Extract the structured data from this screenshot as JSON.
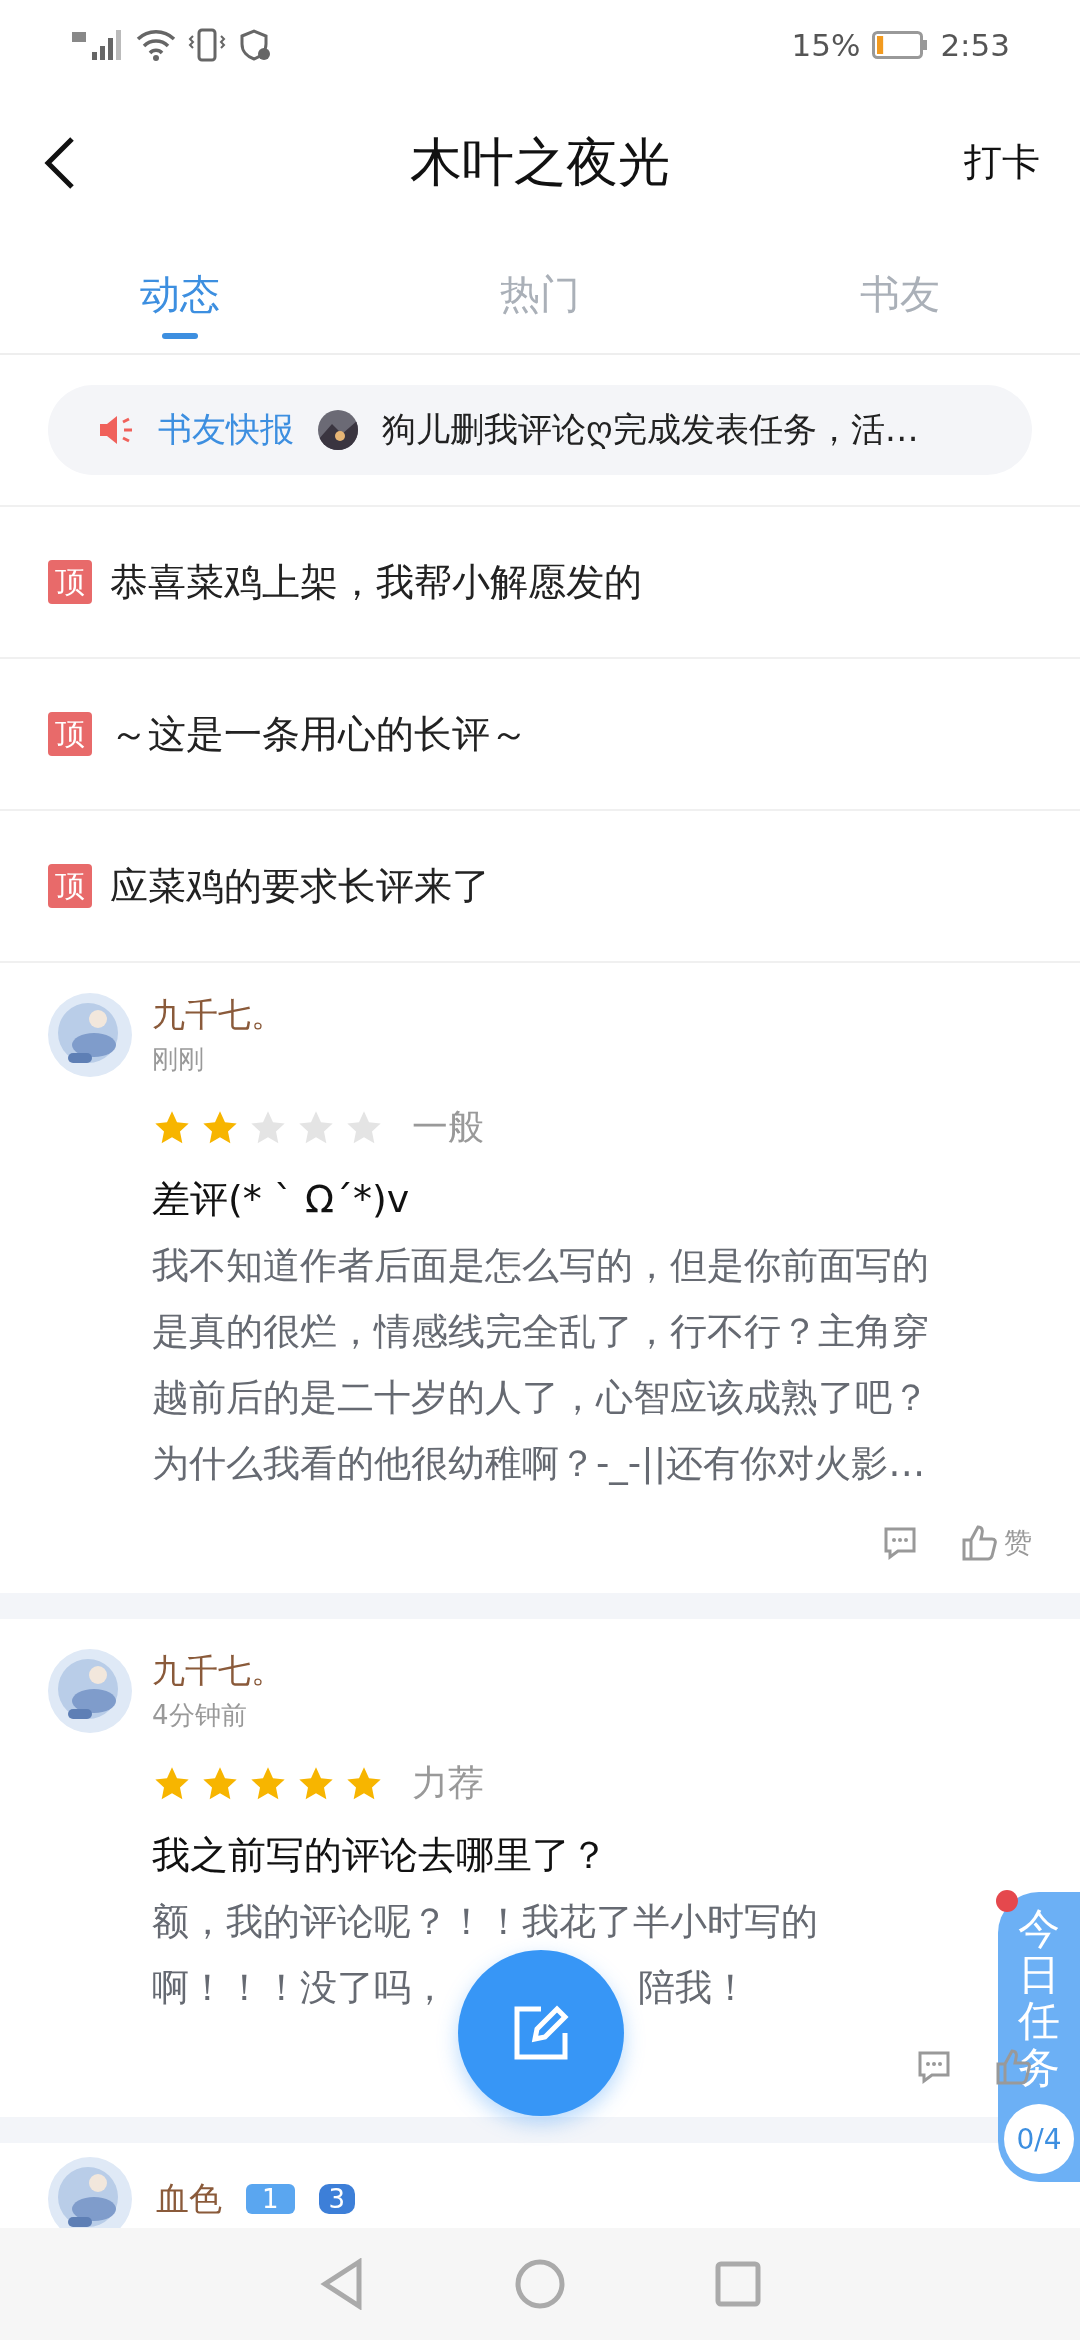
{
  "status_bar": {
    "battery": "15%",
    "time": "2:53"
  },
  "header": {
    "title": "木叶之夜光",
    "action": "打卡"
  },
  "tabs": [
    {
      "label": "动态",
      "selected": true
    },
    {
      "label": "热门",
      "selected": false
    },
    {
      "label": "书友",
      "selected": false
    }
  ],
  "notice": {
    "label": "书友快报",
    "text": "狗儿删我评论ღ完成发表任务，活…"
  },
  "pinned": [
    {
      "badge": "顶",
      "title": "恭喜菜鸡上架，我帮小解愿发的"
    },
    {
      "badge": "顶",
      "title": "～这是一条用心的长评～"
    },
    {
      "badge": "顶",
      "title": "应菜鸡的要求长评来了"
    }
  ],
  "posts": [
    {
      "name": "九千七。",
      "time": "刚刚",
      "stars": 2,
      "rating": "一般",
      "title": "差评(* ` Ω´*)v",
      "body": [
        [
          "我不知道作者后面是怎么写的，但是你前面写的"
        ],
        [
          "是真的很烂，情感线完全乱了，行不行？主角穿"
        ],
        [
          "越前后的是二十岁的人了，心智应该成熟了吧？"
        ],
        [
          "为什么我看的他很幼稚啊？-_-||还有你对火影…"
        ]
      ],
      "like": "赞"
    },
    {
      "name": "九千七。",
      "time": "4分钟前",
      "stars": 5,
      "rating": "力荐",
      "title": "我之前写的评论去哪里了？",
      "body": [
        [
          "额，我的评论呢？！！我花了半小时写的"
        ],
        [
          "啊！！！没了吗，",
          "陪我！"
        ]
      ]
    }
  ],
  "partial_post": {
    "name": "血色",
    "level": "1",
    "medal": "3"
  },
  "task_panel": {
    "label": "今日任务",
    "progress": "0/4"
  }
}
